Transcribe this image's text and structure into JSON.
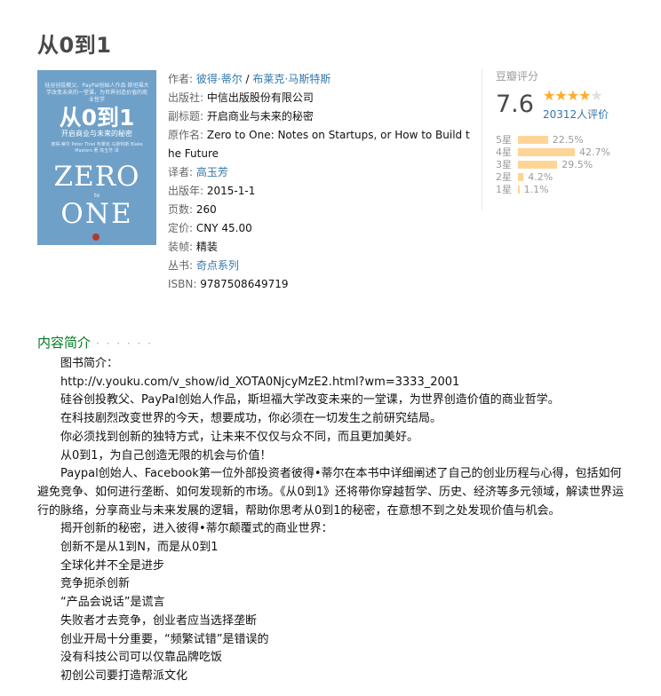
{
  "title": "从0到1",
  "cover": {
    "top_text": "硅谷创投教父、PayPal创始人作品 斯坦福大学改变未来的一堂课，为世界创造价值的商业哲学",
    "big_title": "从0到1",
    "sub_title": "开启商业与未来的秘密",
    "tiny_text": "彼得·蒂尔 Peter Thiel 布莱克·马斯特斯 Blake Masters 著 高玉芳 译",
    "zero": "ZERO",
    "to": "to",
    "one": "ONE"
  },
  "info": {
    "author_label": "作者:",
    "author1": "彼得·蒂尔",
    "author_sep": " / ",
    "author2": "布莱克·马斯特斯",
    "publisher_label": "出版社:",
    "publisher": "中信出版股份有限公司",
    "subtitle_label": "副标题:",
    "subtitle": "开启商业与未来的秘密",
    "original_label": "原作名:",
    "original": "Zero to One: Notes on Startups, or How to Build the Future",
    "translator_label": "译者:",
    "translator": "高玉芳",
    "year_label": "出版年:",
    "year": "2015-1-1",
    "pages_label": "页数:",
    "pages": "260",
    "price_label": "定价:",
    "price": "CNY 45.00",
    "binding_label": "装帧:",
    "binding": "精装",
    "series_label": "丛书:",
    "series": "奇点系列",
    "isbn_label": "ISBN:",
    "isbn": "9787508649719"
  },
  "rating": {
    "title": "豆瓣评分",
    "score": "7.6",
    "stars_on": "★★★★",
    "stars_off": "★",
    "stars_value": 4,
    "votes": "20312人评价",
    "bars": [
      {
        "label": "5星",
        "pct_text": "22.5%",
        "pct": 22.5
      },
      {
        "label": "4星",
        "pct_text": "42.7%",
        "pct": 42.7
      },
      {
        "label": "3星",
        "pct_text": "29.5%",
        "pct": 29.5
      },
      {
        "label": "2星",
        "pct_text": "4.2%",
        "pct": 4.2
      },
      {
        "label": "1星",
        "pct_text": "1.1%",
        "pct": 1.1
      }
    ],
    "bar_color": "#ffd596"
  },
  "intro": {
    "heading": "内容简介",
    "dots": "· · · · · ·",
    "heading_color": "#007722",
    "paragraphs": [
      "图书简介：",
      "http://v.youku.com/v_show/id_XOTA0NjcyMzE2.html?wm=3333_2001",
      "硅谷创投教父、PayPal创始人作品，斯坦福大学改变未来的一堂课，为世界创造价值的商业哲学。",
      "在科技剧烈改变世界的今天，想要成功，你必须在一切发生之前研究结局。",
      "你必须找到创新的独特方式，让未来不仅仅与众不同，而且更加美好。",
      "从0到1，为自己创造无限的机会与价值！",
      "Paypal创始人、Facebook第一位外部投资者彼得•蒂尔在本书中详细阐述了自己的创业历程与心得，包括如何避免竞争、如何进行垄断、如何发现新的市场。《从0到1》还将带你穿越哲学、历史、经济等多元领域，解读世界运行的脉络，分享商业与未来发展的逻辑，帮助你思考从0到1的秘密，在意想不到之处发现价值与机会。",
      "揭开创新的秘密，进入彼得•蒂尔颠覆式的商业世界：",
      "创新不是从1到N，而是从0到1",
      "全球化并不全是进步",
      "竞争扼杀创新",
      "“产品会说话”是谎言",
      "失败者才去竞争，创业者应当选择垄断",
      "创业开局十分重要，“频繁试错”是错误的",
      "没有科技公司可以仅靠品牌吃饭",
      "初创公司要打造帮派文化"
    ]
  }
}
